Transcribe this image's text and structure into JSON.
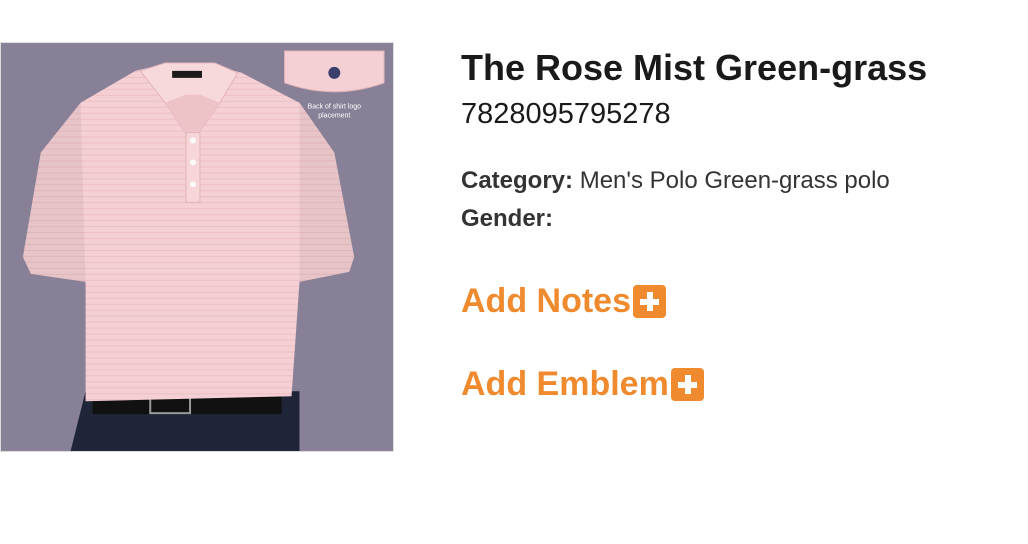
{
  "product": {
    "title": "The Rose Mist Green-grass",
    "sku": "7828095795278",
    "category_label": "Category:",
    "category_value": "Men's Polo Green-grass polo",
    "gender_label": "Gender:",
    "gender_value": "",
    "image": {
      "inset_caption_line1": "Back of shirt logo",
      "inset_caption_line2": "placement"
    }
  },
  "actions": {
    "add_notes_label": "Add Notes",
    "add_emblem_label": "Add Emblem",
    "icon": "plus-square-icon"
  },
  "colors": {
    "accent": "#f08a2e",
    "shirt": "#f4cfd3",
    "backdrop": "#878096",
    "pants": "#1f2438"
  }
}
